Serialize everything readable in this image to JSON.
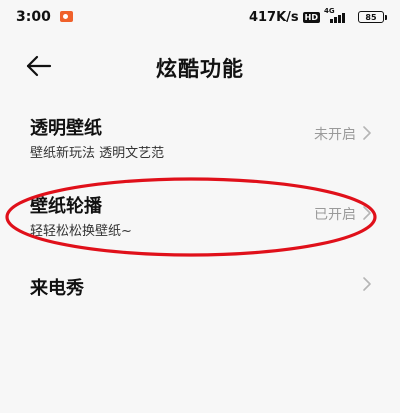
{
  "status_bar": {
    "time": "3:00",
    "net_speed": "417K/s",
    "hd_badge": "HD",
    "network_type": "4G",
    "battery": "85"
  },
  "header": {
    "title": "炫酷功能"
  },
  "rows": [
    {
      "title": "透明壁纸",
      "subtitle": "壁纸新玩法 透明文艺范",
      "status": "未开启"
    },
    {
      "title": "壁纸轮播",
      "subtitle": "轻轻松松换壁纸~",
      "status": "已开启"
    },
    {
      "title": "来电秀"
    }
  ],
  "colors": {
    "background": "#f7f7f7",
    "status_text": "#9a9a9a",
    "annotation_red": "#e0101a",
    "recording_badge": "#f0612b"
  },
  "icons": {
    "back": "back-arrow-icon",
    "chevron": "chevron-right-icon",
    "recording": "screen-record-icon",
    "signal": "signal-bars-icon",
    "battery": "battery-icon"
  }
}
